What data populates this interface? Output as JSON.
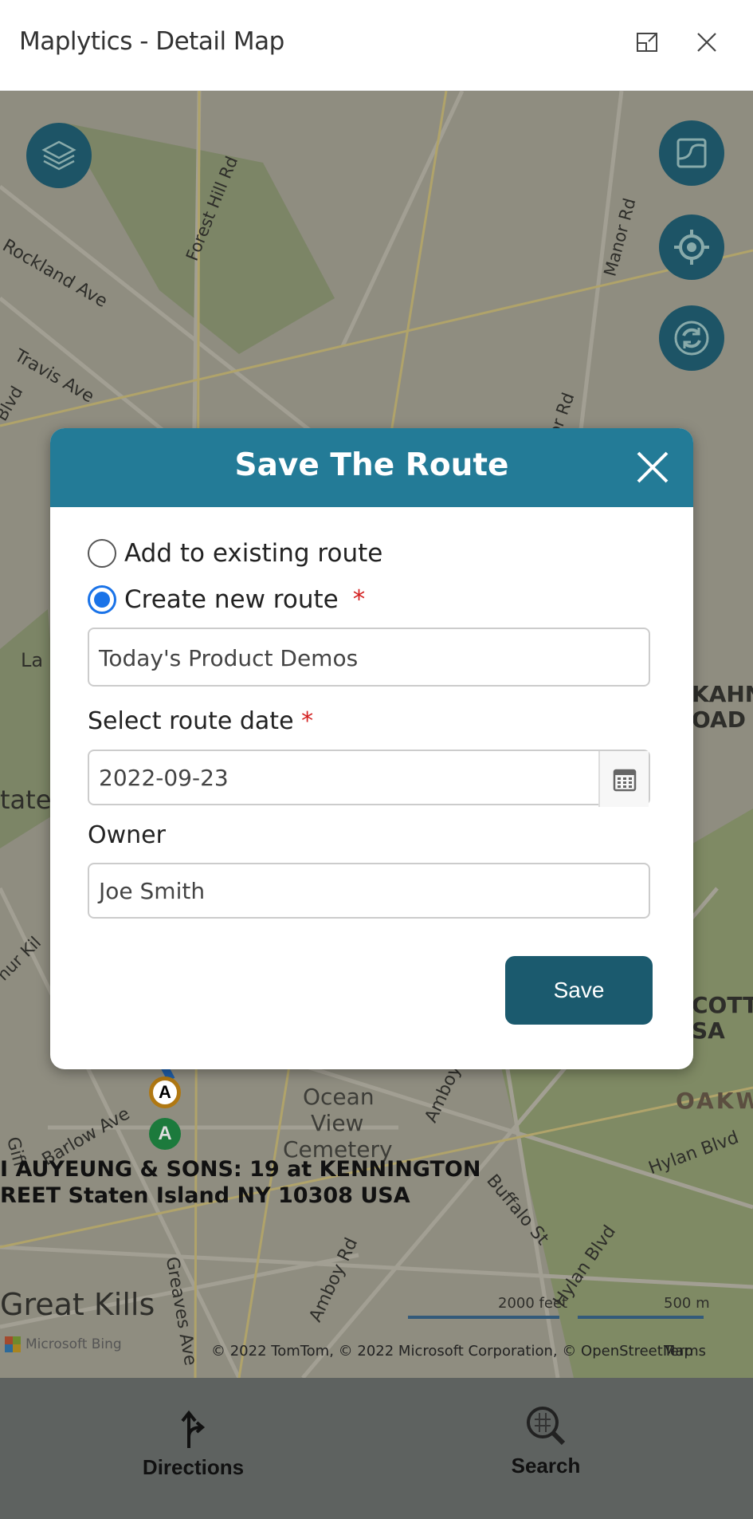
{
  "header": {
    "title": "Maplytics - Detail Map",
    "popout_icon": "popout-icon",
    "close_icon": "close-icon"
  },
  "map": {
    "labels": {
      "forest_hill": "Forest Hill Rd",
      "rockland": "Rockland Ave",
      "travis": "Travis Ave",
      "manor": "Manor Rd",
      "blvd": "Blvd",
      "or_rd": "or Rd",
      "la": "La",
      "state": "tate",
      "kahn": "KAHN",
      "oad": "OAD S",
      "ocean": "Ocean",
      "view": "View",
      "cemetery": "Cemetery",
      "barlow": "Barlow Ave",
      "giff": "Giff",
      "amboy": "Amboy Rd",
      "amboy_rd2": "Amboy Rd",
      "buffalo": "Buffalo St",
      "hylan": "Hylan Blvd",
      "hylan2": "Hylan Blvd",
      "oakw": "OAKW",
      "cott": "COTT",
      "sa": "SA",
      "greaves": "Greaves Ave",
      "great_kills": "Great Kills",
      "kilb": "hur Kil"
    },
    "pin_label": "A",
    "location_line1": "I AUYEUNG & SONS: 19 at KENNINGTON",
    "location_line2": "REET Staten Island NY 10308 USA",
    "scale_feet": "2000 feet",
    "scale_m": "500 m",
    "bing": "Microsoft Bing",
    "copyright": "© 2022 TomTom, © 2022 Microsoft Corporation, © OpenStreetMap",
    "terms": "Terms",
    "buttons": [
      "layers-icon",
      "map-style-icon",
      "locate-icon",
      "refresh-icon"
    ]
  },
  "dialog": {
    "title": "Save The Route",
    "option_existing": "Add to existing route",
    "option_new": "Create new route",
    "selected_option": "new",
    "required_mark": "*",
    "route_name": "Today's Product Demos",
    "date_label": "Select route date",
    "date_value": "2022-09-23",
    "owner_label": "Owner",
    "owner_value": "Joe Smith",
    "save_label": "Save"
  },
  "bottom_nav": {
    "directions": "Directions",
    "search": "Search"
  },
  "colors": {
    "dialog_header": "#237b97",
    "save_button": "#1b5a6e",
    "radio_selected": "#1a73e8",
    "required": "#d32020",
    "map_button": "#1d5466"
  }
}
